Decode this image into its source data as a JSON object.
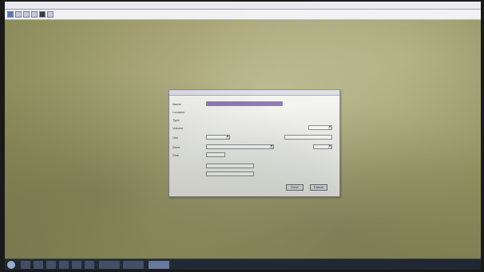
{
  "window": {
    "title": ""
  },
  "dialog": {
    "fields": [
      {
        "label": "Name",
        "value": ""
      },
      {
        "label": "Location",
        "value": ""
      },
      {
        "label": "Type",
        "value": ""
      },
      {
        "label": "Volume",
        "value": ""
      },
      {
        "label": "Use",
        "value": ""
      },
      {
        "label": "Drive",
        "value": ""
      },
      {
        "label": "Disk",
        "value": ""
      }
    ],
    "ok_label": "Done",
    "cancel_label": "Cancel"
  },
  "taskbar": {
    "clock": ""
  },
  "icons": {
    "start": "windows-start-icon",
    "apps": [
      "explorer-icon",
      "browser-icon",
      "folder-icon",
      "mail-icon",
      "app-icon",
      "settings-icon",
      "terminal-icon",
      "picture-icon"
    ]
  }
}
